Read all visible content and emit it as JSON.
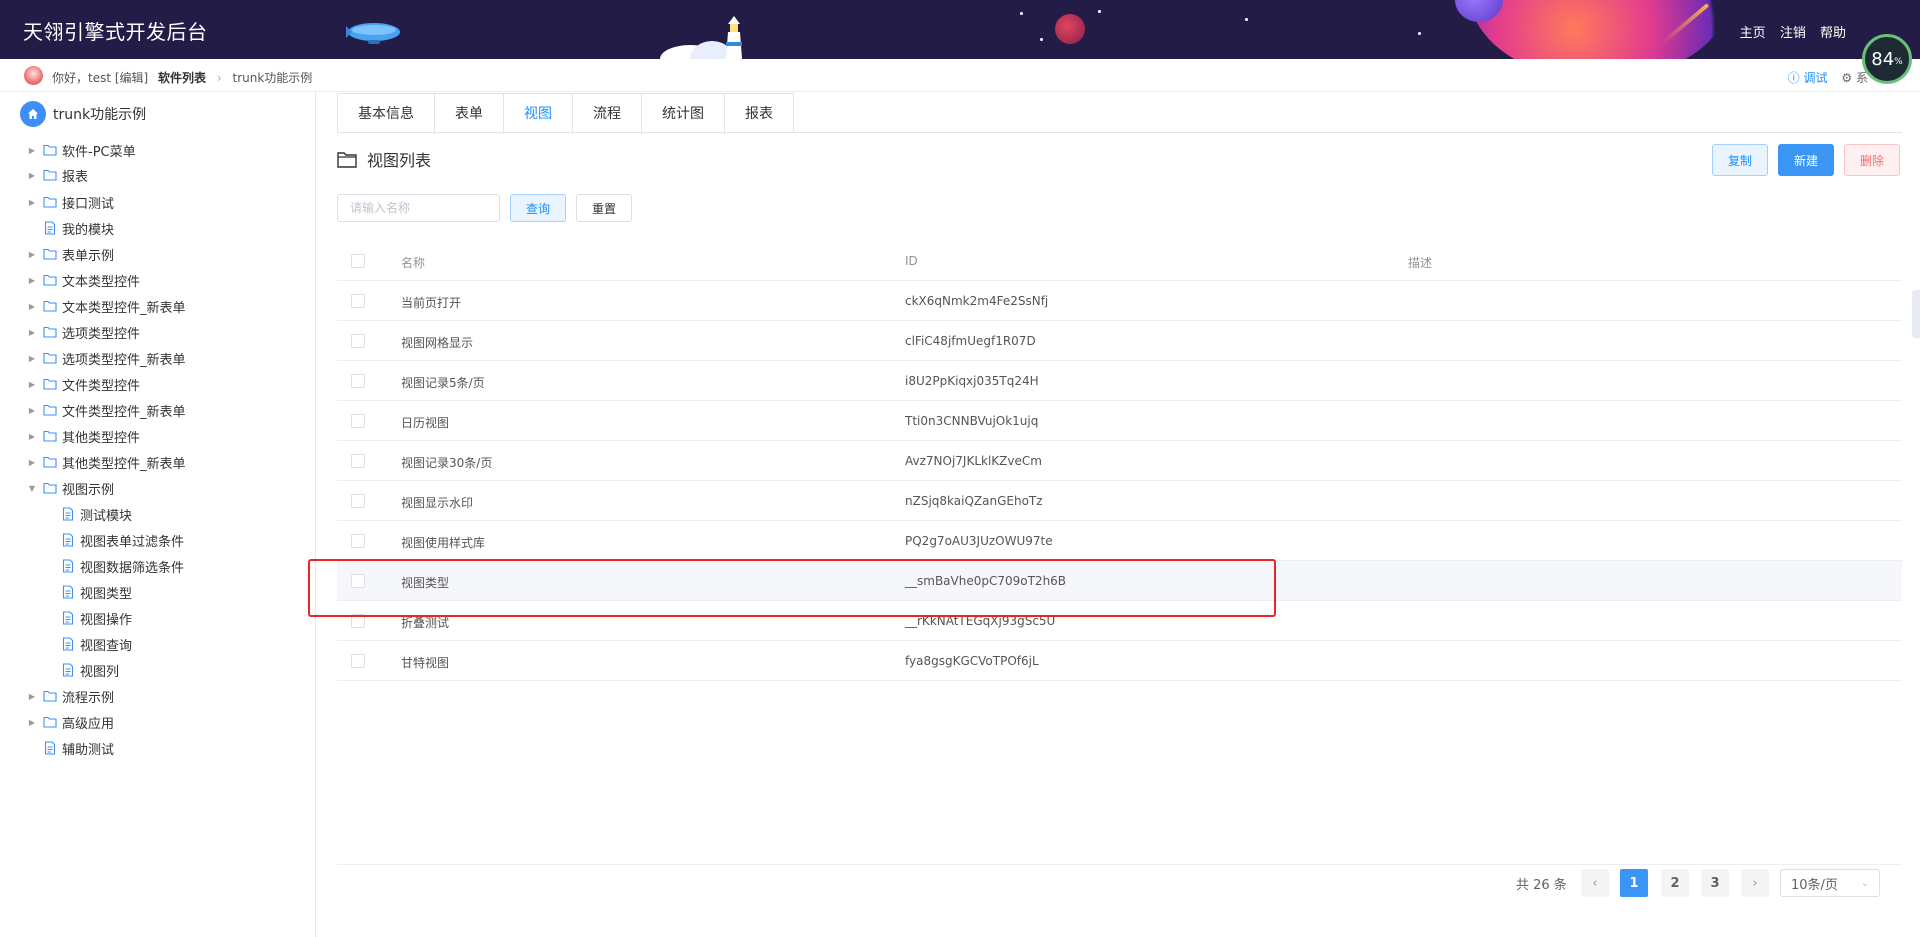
{
  "header": {
    "app_title": "天翎引擎式开发后台",
    "links": [
      "主页",
      "注销",
      "帮助"
    ],
    "perf_value": "84",
    "perf_unit": "%"
  },
  "breadcrumb": {
    "greeting": "你好，test [编辑]",
    "crumb_1": "软件列表",
    "crumb_2": "trunk功能示例",
    "debug": "调试",
    "system": "系"
  },
  "sidebar": {
    "root": "trunk功能示例",
    "items": [
      {
        "label": "软件-PC菜单",
        "type": "folder"
      },
      {
        "label": "报表",
        "type": "folder"
      },
      {
        "label": "接口测试",
        "type": "folder"
      },
      {
        "label": "我的模块",
        "type": "file"
      },
      {
        "label": "表单示例",
        "type": "folder"
      },
      {
        "label": "文本类型控件",
        "type": "folder"
      },
      {
        "label": "文本类型控件_新表单",
        "type": "folder"
      },
      {
        "label": "选项类型控件",
        "type": "folder"
      },
      {
        "label": "选项类型控件_新表单",
        "type": "folder"
      },
      {
        "label": "文件类型控件",
        "type": "folder"
      },
      {
        "label": "文件类型控件_新表单",
        "type": "folder"
      },
      {
        "label": "其他类型控件",
        "type": "folder"
      },
      {
        "label": "其他类型控件_新表单",
        "type": "folder"
      },
      {
        "label": "视图示例",
        "type": "folder-open"
      },
      {
        "label": "测试模块",
        "type": "file"
      },
      {
        "label": "视图表单过滤条件",
        "type": "file"
      },
      {
        "label": "视图数据筛选条件",
        "type": "file"
      },
      {
        "label": "视图类型",
        "type": "file"
      },
      {
        "label": "视图操作",
        "type": "file"
      },
      {
        "label": "视图查询",
        "type": "file"
      },
      {
        "label": "视图列",
        "type": "file"
      },
      {
        "label": "流程示例",
        "type": "folder"
      },
      {
        "label": "高级应用",
        "type": "folder"
      },
      {
        "label": "辅助测试",
        "type": "file"
      }
    ]
  },
  "tabs": [
    "基本信息",
    "表单",
    "视图",
    "流程",
    "统计图",
    "报表"
  ],
  "active_tab": "视图",
  "section": {
    "title": "视图列表"
  },
  "toolbar": {
    "copy": "复制",
    "new": "新建",
    "delete": "删除"
  },
  "search": {
    "placeholder": "请输入名称",
    "value": "",
    "query": "查询",
    "reset": "重置"
  },
  "table": {
    "columns": [
      "名称",
      "ID",
      "描述"
    ],
    "rows": [
      {
        "name": "当前页打开",
        "id": "ckX6qNmk2m4Fe2SsNfj",
        "desc": ""
      },
      {
        "name": "视图网格显示",
        "id": "clFiC48jfmUegf1R07D",
        "desc": ""
      },
      {
        "name": "视图记录5条/页",
        "id": "i8U2PpKiqxj035Tq24H",
        "desc": ""
      },
      {
        "name": "日历视图",
        "id": "Tti0n3CNNBVujOk1ujq",
        "desc": ""
      },
      {
        "name": "视图记录30条/页",
        "id": "Avz7NOj7JKLklKZveCm",
        "desc": ""
      },
      {
        "name": "视图显示水印",
        "id": "nZSjq8kaiQZanGEhoTz",
        "desc": ""
      },
      {
        "name": "视图使用样式库",
        "id": "PQ2g7oAU3JUzOWU97te",
        "desc": ""
      },
      {
        "name": "视图类型",
        "id": "__smBaVhe0pC709oT2h6B",
        "desc": ""
      },
      {
        "name": "折叠测试",
        "id": "__rKkNAtTEGqXj93gSc5U",
        "desc": ""
      },
      {
        "name": "甘特视图",
        "id": "fya8gsgKGCVoTPOf6jL",
        "desc": ""
      }
    ]
  },
  "pagination": {
    "total": "共 26 条",
    "pages": [
      "1",
      "2",
      "3"
    ],
    "current": "1",
    "page_size": "10条/页"
  },
  "colors": {
    "header_bg": "#221c47",
    "primary": "#1890ff",
    "danger": "#f56c6c",
    "highlight": "#e8262a"
  }
}
